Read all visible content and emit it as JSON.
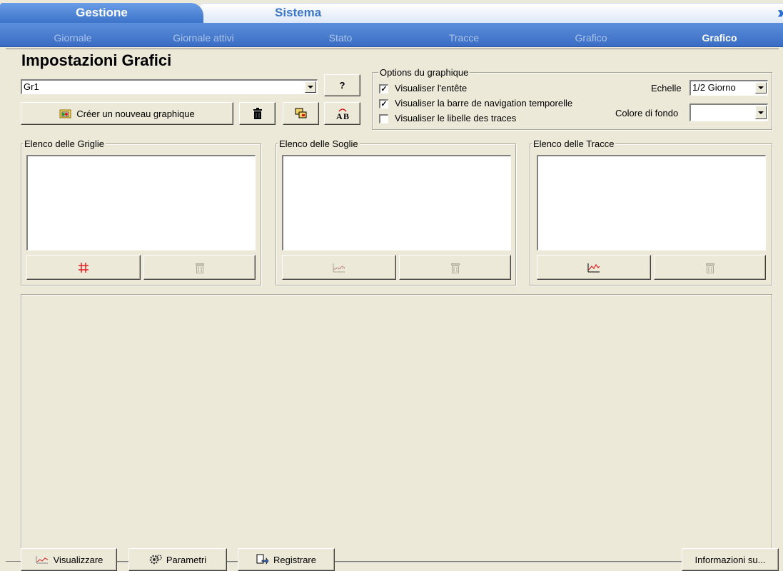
{
  "tabs": {
    "primary": "Gestione",
    "secondary": "Sistema"
  },
  "subnav": [
    "Giornale",
    "Giornale attivi",
    "Stato",
    "Tracce",
    "Grafico",
    "Grafico"
  ],
  "page": {
    "title": "Impostazioni Grafici"
  },
  "graph_select": {
    "value": "Gr1",
    "help_label": "?"
  },
  "create_button": {
    "label": "Créer un nouveau graphique"
  },
  "options": {
    "title": "Options du graphique",
    "checkboxes": [
      {
        "label": "Visualiser l'entête",
        "checked": true
      },
      {
        "label": "Visualiser la barre de navigation temporelle",
        "checked": true
      },
      {
        "label": "Visualiser le libelle des traces",
        "checked": false
      }
    ],
    "scale_label": "Echelle",
    "scale_value": "1/2 Giorno",
    "bg_label": "Colore di fondo",
    "bg_value": ""
  },
  "lists": {
    "grids": {
      "title": "Elenco delle Griglie"
    },
    "thresholds": {
      "title": "Elenco delle Soglie"
    },
    "traces": {
      "title": "Elenco delle Tracce"
    }
  },
  "footer": {
    "visualize": "Visualizzare",
    "params": "Parametri",
    "save": "Registrare",
    "about": "Informazioni su..."
  },
  "colors": {
    "accent": "#3a6cc4",
    "background": "#ece9d8"
  }
}
